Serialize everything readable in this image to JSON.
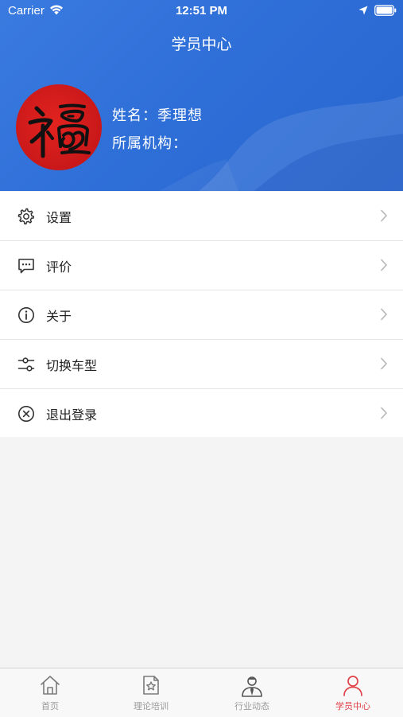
{
  "status_bar": {
    "carrier": "Carrier",
    "time": "12:51 PM"
  },
  "nav": {
    "title": "学员中心"
  },
  "profile": {
    "name_label": "姓名：",
    "name_value": "季理想",
    "org_label": "所属机构：",
    "org_value": "",
    "avatar_text": "福"
  },
  "menu": {
    "items": [
      {
        "label": "设置",
        "icon": "gear-icon"
      },
      {
        "label": "评价",
        "icon": "comment-icon"
      },
      {
        "label": "关于",
        "icon": "info-icon"
      },
      {
        "label": "切换车型",
        "icon": "sliders-icon"
      },
      {
        "label": "退出登录",
        "icon": "close-circle-icon"
      }
    ]
  },
  "tabs": [
    {
      "label": "首页",
      "icon": "home-icon"
    },
    {
      "label": "理论培训",
      "icon": "document-star-icon"
    },
    {
      "label": "行业动态",
      "icon": "person-tie-icon"
    },
    {
      "label": "学员中心",
      "icon": "user-icon",
      "active": true
    }
  ],
  "colors": {
    "header_blue": "#2f6fd8",
    "active_tab": "#e0424a",
    "inactive_tab": "#9a9a9a"
  }
}
